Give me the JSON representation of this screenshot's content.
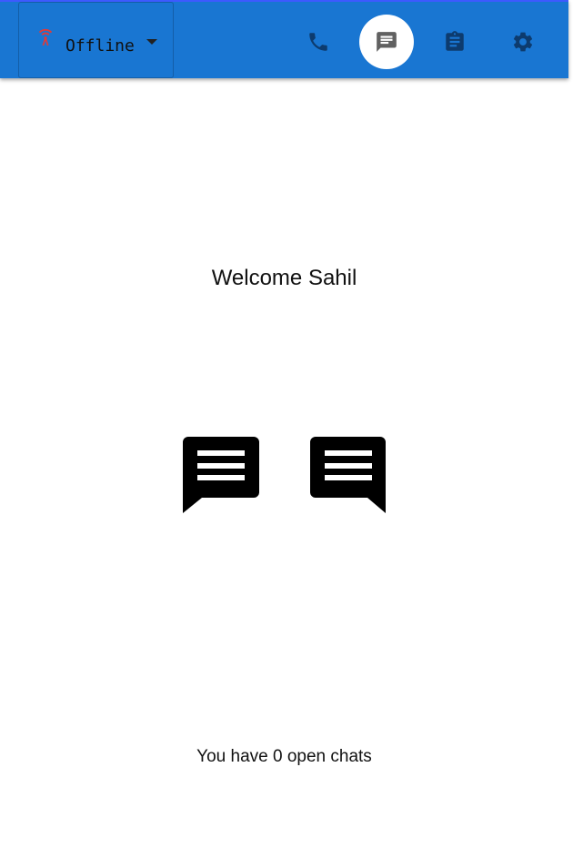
{
  "header": {
    "status": {
      "label": "Offline",
      "icon": "antenna-icon",
      "icon_color": "#e53935"
    },
    "nav": [
      {
        "name": "phone",
        "icon": "phone-icon",
        "active": false
      },
      {
        "name": "chat",
        "icon": "chat-icon",
        "active": true
      },
      {
        "name": "clipboard",
        "icon": "clipboard-icon",
        "active": false
      },
      {
        "name": "settings",
        "icon": "gear-icon",
        "active": false
      }
    ],
    "colors": {
      "bar": "#1976d2",
      "icon": "#0d3b6e",
      "active_icon": "#616161"
    }
  },
  "main": {
    "welcome": "Welcome Sahil",
    "icons": [
      "chat-bubble-left-icon",
      "chat-bubble-right-icon"
    ],
    "open_chats": "You have 0 open chats"
  }
}
